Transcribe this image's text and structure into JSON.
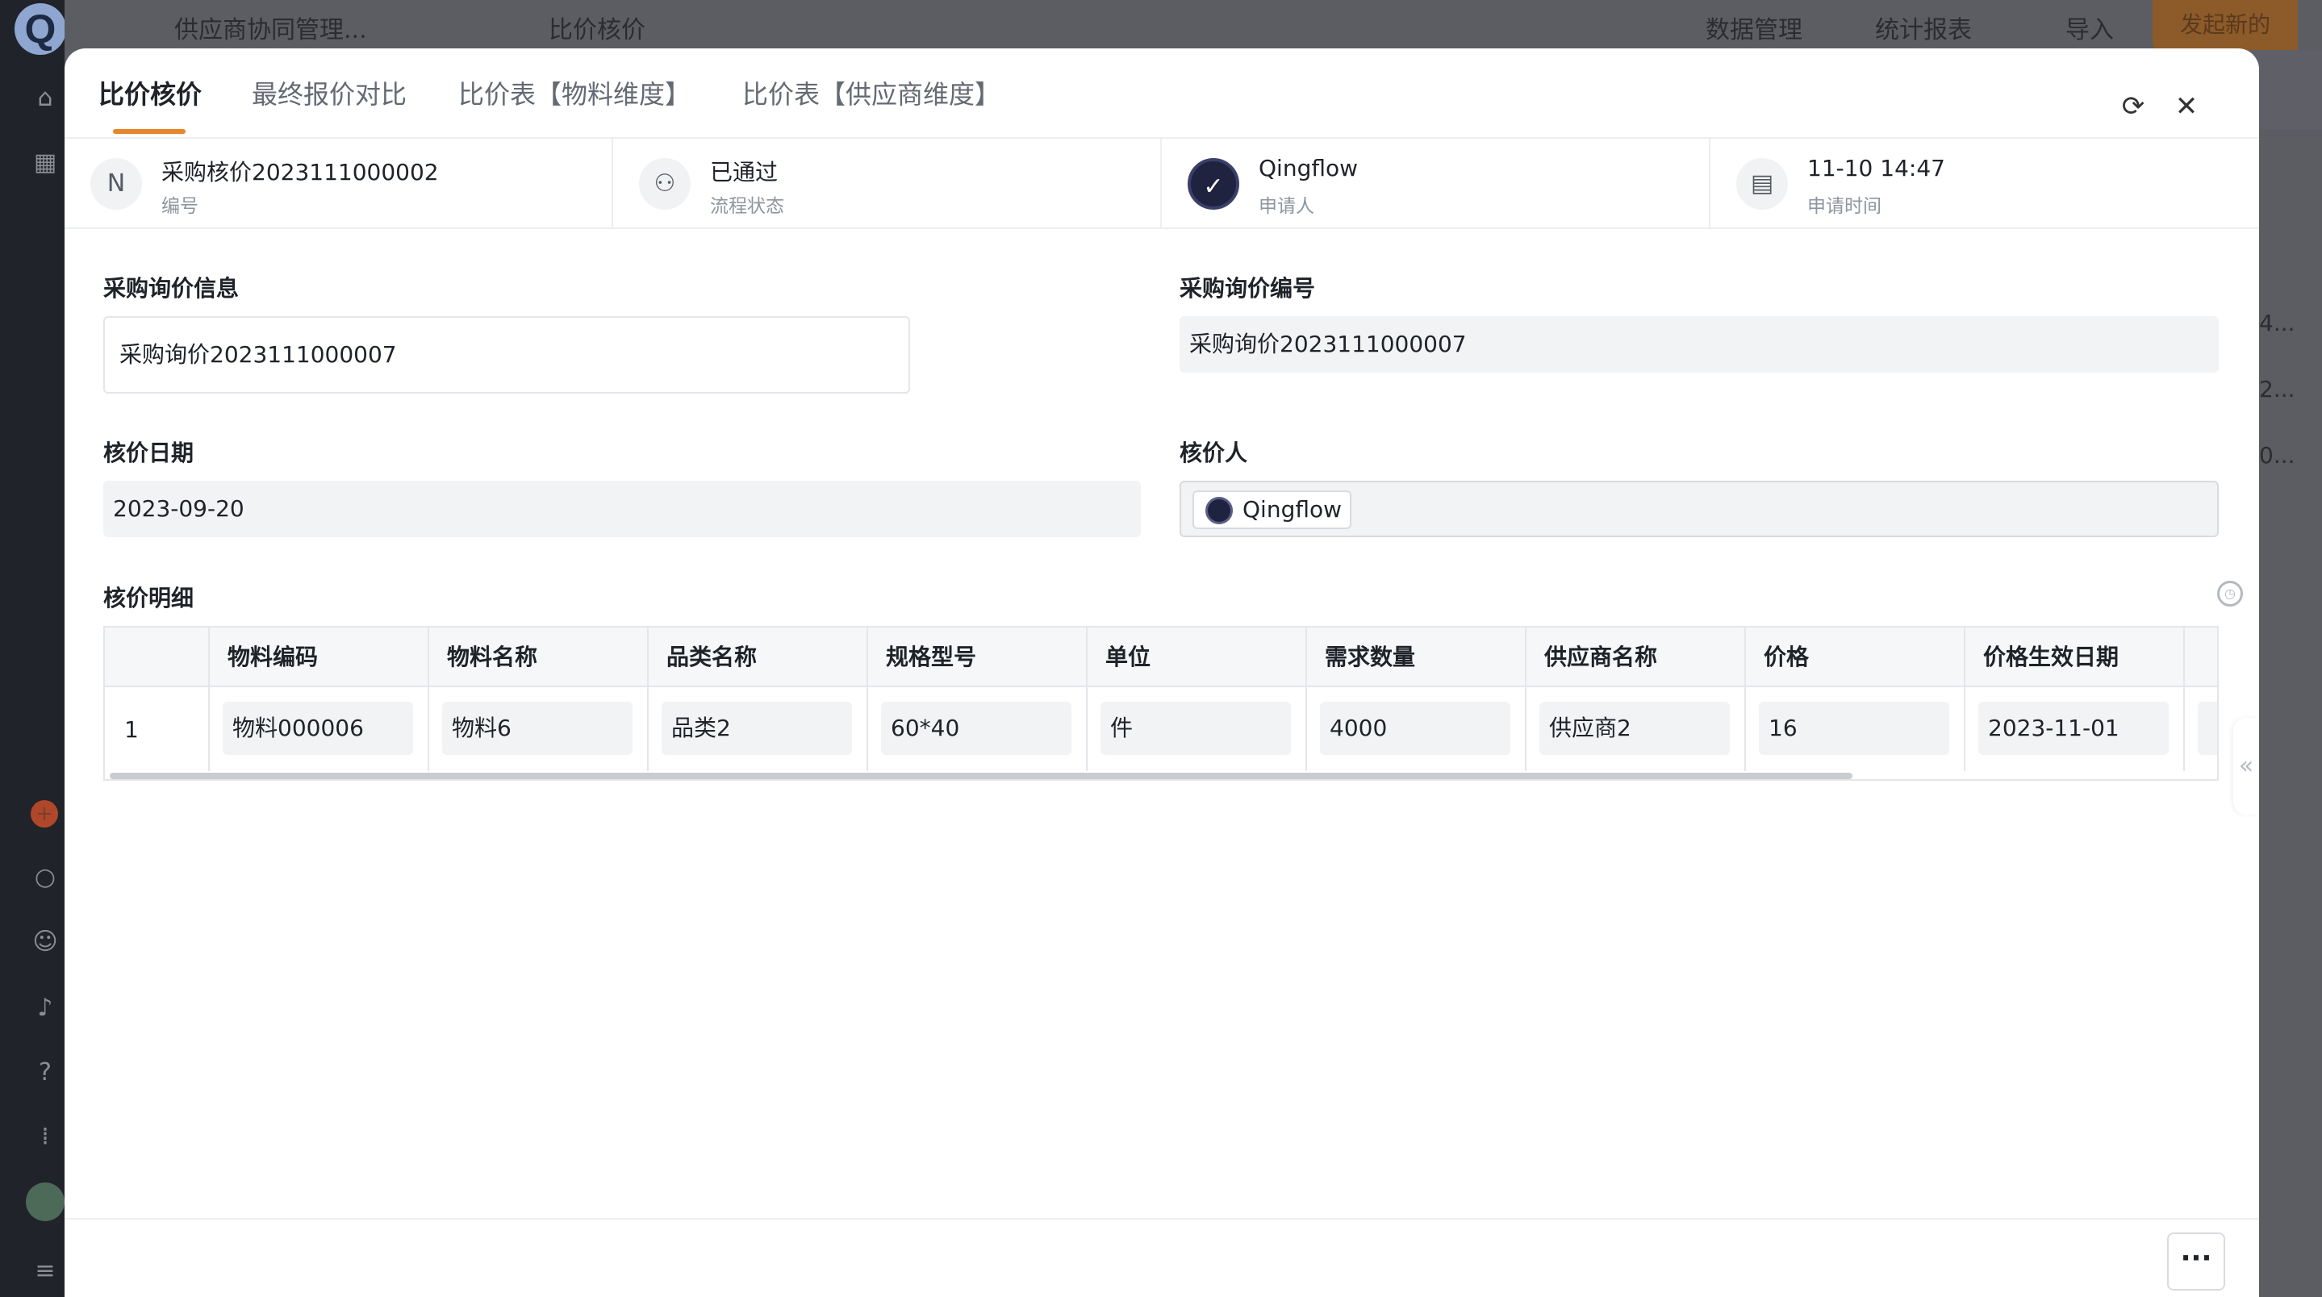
{
  "background": {
    "app_name": "供应商协同管理...",
    "page_name": "比价核价",
    "data_manage": "数据管理",
    "stats": "统计报表",
    "import": "导入",
    "new_button": "发起新的",
    "right_texts": [
      "4...",
      "2...",
      "0..."
    ]
  },
  "modal": {
    "tabs": [
      "比价核价",
      "最终报价对比",
      "比价表【物料维度】",
      "比价表【供应商维度】"
    ],
    "info": [
      {
        "main": "采购核价2023111000002",
        "sub": "编号",
        "icon": "n-icon"
      },
      {
        "main": "已通过",
        "sub": "流程状态",
        "icon": "workflow-icon"
      },
      {
        "main": "Qingflow",
        "sub": "申请人",
        "icon": "avatar"
      },
      {
        "main": "11-10 14:47",
        "sub": "申请时间",
        "icon": "calendar-icon"
      }
    ],
    "fields": {
      "inquiry_info_label": "采购询价信息",
      "inquiry_info_value": "采购询价2023111000007",
      "inquiry_no_label": "采购询价编号",
      "inquiry_no_value": "采购询价2023111000007",
      "date_label": "核价日期",
      "date_value": "2023-09-20",
      "person_label": "核价人",
      "person_value": "Qingflow"
    },
    "detail_label": "核价明细",
    "table": {
      "headers": [
        "物料编码",
        "物料名称",
        "品类名称",
        "规格型号",
        "单位",
        "需求数量",
        "供应商名称",
        "价格",
        "价格生效日期"
      ],
      "rows": [
        {
          "num": "1",
          "cells": [
            "物料000006",
            "物料6",
            "品类2",
            "60*40",
            "件",
            "4000",
            "供应商2",
            "16",
            "2023-11-01"
          ]
        }
      ]
    }
  }
}
